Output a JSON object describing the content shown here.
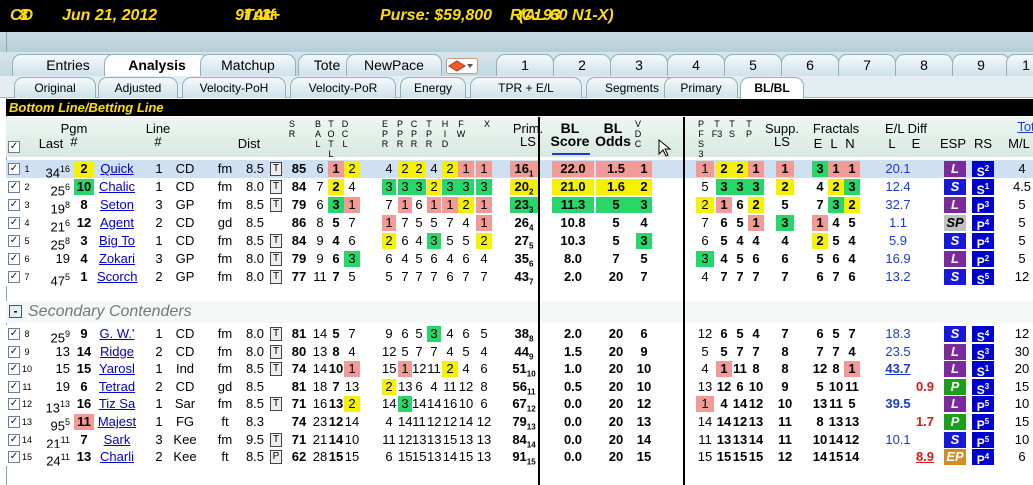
{
  "title": {
    "track": "CD",
    "race": "8",
    "date": "Jun 21, 2012",
    "dist": "9f",
    "surface": "Turf",
    "type": "AL",
    "age": "3+",
    "purse": "Purse: $59,800",
    "rc": "RC: 93",
    "cond": "(AL 60 N1-X)"
  },
  "tabs1": [
    "Entries",
    "Analysis",
    "Matchup",
    "Tote",
    "NewPace",
    "1",
    "2",
    "3",
    "4",
    "5",
    "6",
    "7",
    "8",
    "9",
    "1"
  ],
  "tabs2": [
    "Original",
    "Adjusted",
    "Velocity-PoH",
    "Velocity-PoR",
    "Energy",
    "TPR + E/L",
    "Segments",
    "Primary",
    "BL/BL"
  ],
  "section": "Bottom Line/Betting Line",
  "headers": {
    "last": "Last",
    "pgm": "Pgm\n#",
    "line": "Line\n#",
    "dist": "Dist",
    "sr": "S\nR",
    "batl": "B\nA\nL",
    "totl": "T\nO\nT\nL",
    "dcl": "D\nC\nL",
    "epr": "E\nP\nR",
    "ppr": "P\nP\nR",
    "cpr": "C\nP\nR",
    "tpr": "T\nP\nR",
    "hid": "H\nI\nD",
    "fw": "F\nW",
    "x": "X",
    "prim": "Prim.\nLS",
    "bl1": "BL\nScore",
    "bl2": "BL\nOdds",
    "vdc": "V\nD\nC",
    "pfs3": "P\nF\nS\n3",
    "tf3": "T\nF3",
    "ts": "T\nS",
    "tp": "T\nP",
    "supp": "Supp.\nLS",
    "fractals": "Fractals",
    "e": "E",
    "l": "L",
    "n": "N",
    "el": "E/L Diff",
    "elL": "L",
    "elE": "E",
    "esp": "ESP",
    "rs": "RS",
    "tot": "Tot",
    "ml": "M/L"
  },
  "secondary_label": "Secondary Contenders",
  "rows": [
    {
      "n": "1",
      "last": "34",
      "lastsup": "16",
      "pgm": "2",
      "name": "Quick",
      "ln": "1",
      "trk": "CD",
      "cond": "fm",
      "dist": "8.5",
      "t": "T",
      "sr": "85",
      "ba": "6",
      "to": "1",
      "dc": "2",
      "e": "4",
      "p": "2",
      "cp": "2",
      "tp": "4",
      "hi": "2",
      "fw": "1",
      "x": "1",
      "prim": "16",
      "primsup": "1",
      "bl1": "22.0",
      "bl2": "1.5",
      "vdc": "1",
      "pf": "1",
      "tf": "2",
      "ts": "2",
      "tpp": "1",
      "supp": "1",
      "fe": "3",
      "fl": "1",
      "fn": "1",
      "el": "20.1",
      "ee": "",
      "esp": "L",
      "rs": "S",
      "rssup": "2",
      "ml": "4"
    },
    {
      "n": "2",
      "last": "25",
      "lastsup": "6",
      "pgm": "10",
      "name": "Chalic",
      "ln": "1",
      "trk": "CD",
      "cond": "fm",
      "dist": "8.0",
      "t": "T",
      "sr": "84",
      "ba": "7",
      "to": "2",
      "dc": "4",
      "e": "3",
      "p": "3",
      "cp": "3",
      "tp": "2",
      "hi": "3",
      "fw": "3",
      "x": "3",
      "prim": "20",
      "primsup": "2",
      "bl1": "21.0",
      "bl2": "1.6",
      "vdc": "2",
      "pf": "5",
      "tf": "3",
      "ts": "3",
      "tpp": "3",
      "supp": "2",
      "fe": "4",
      "fl": "2",
      "fn": "3",
      "el": "12.4",
      "ee": "",
      "esp": "S",
      "rs": "S",
      "rssup": "1",
      "ml": "4.5"
    },
    {
      "n": "3",
      "last": "19",
      "lastsup": "8",
      "pgm": "8",
      "name": "Seton",
      "ln": "3",
      "trk": "GP",
      "cond": "fm",
      "dist": "8.5",
      "t": "T",
      "sr": "79",
      "ba": "6",
      "to": "3",
      "dc": "1",
      "e": "7",
      "p": "1",
      "cp": "6",
      "tp": "1",
      "hi": "1",
      "fw": "2",
      "x": "1",
      "prim": "23",
      "primsup": "3",
      "bl1": "11.3",
      "bl2": "5",
      "vdc": "3",
      "pf": "2",
      "tf": "1",
      "ts": "6",
      "tpp": "2",
      "supp": "5",
      "fe": "7",
      "fl": "3",
      "fn": "2",
      "el": "32.7",
      "ee": "",
      "esp": "L",
      "rs": "P",
      "rssup": "3",
      "ml": "5"
    },
    {
      "n": "4",
      "last": "21",
      "lastsup": "6",
      "pgm": "12",
      "name": "Agent",
      "ln": "2",
      "trk": "CD",
      "cond": "gd",
      "dist": "8.5",
      "t": "",
      "sr": "86",
      "ba": "8",
      "to": "5",
      "dc": "7",
      "e": "1",
      "p": "7",
      "cp": "5",
      "tp": "5",
      "hi": "7",
      "fw": "4",
      "x": "1",
      "prim": "26",
      "primsup": "4",
      "bl1": "10.8",
      "bl2": "5",
      "vdc": "4",
      "pf": "7",
      "tf": "6",
      "ts": "5",
      "tpp": "1",
      "supp": "3",
      "fe": "1",
      "fl": "4",
      "fn": "5",
      "el": "1.1",
      "ee": "",
      "esp": "SP",
      "rs": "P",
      "rssup": "4",
      "ml": "5"
    },
    {
      "n": "5",
      "last": "25",
      "lastsup": "8",
      "pgm": "3",
      "name": "Big To",
      "ln": "1",
      "trk": "CD",
      "cond": "fm",
      "dist": "8.5",
      "t": "T",
      "sr": "84",
      "ba": "9",
      "to": "4",
      "dc": "6",
      "e": "2",
      "p": "6",
      "cp": "4",
      "tp": "3",
      "hi": "5",
      "fw": "5",
      "x": "2",
      "prim": "27",
      "primsup": "5",
      "bl1": "10.3",
      "bl2": "5",
      "vdc": "3",
      "pf": "6",
      "tf": "5",
      "ts": "4",
      "tpp": "4",
      "supp": "4",
      "fe": "2",
      "fl": "5",
      "fn": "4",
      "el": "5.9",
      "ee": "",
      "esp": "S",
      "rs": "P",
      "rssup": "4",
      "ml": "5"
    },
    {
      "n": "6",
      "last": "19",
      "lastsup": "",
      "pgm": "4",
      "name": "Zokari",
      "ln": "3",
      "trk": "GP",
      "cond": "fm",
      "dist": "8.0",
      "t": "T",
      "sr": "79",
      "ba": "9",
      "to": "6",
      "dc": "3",
      "e": "6",
      "p": "4",
      "cp": "5",
      "tp": "6",
      "hi": "4",
      "fw": "6",
      "x": "4",
      "prim": "35",
      "primsup": "6",
      "bl1": "8.0",
      "bl2": "7",
      "vdc": "5",
      "pf": "3",
      "tf": "4",
      "ts": "5",
      "tpp": "6",
      "supp": "6",
      "fe": "5",
      "fl": "6",
      "fn": "4",
      "el": "16.9",
      "ee": "",
      "esp": "L",
      "rs": "P",
      "rssup": "2",
      "ml": "5"
    },
    {
      "n": "7",
      "last": "47",
      "lastsup": "5",
      "pgm": "1",
      "name": "Scorch",
      "ln": "2",
      "trk": "GP",
      "cond": "fm",
      "dist": "8.0",
      "t": "T",
      "sr": "77",
      "ba": "11",
      "to": "7",
      "dc": "5",
      "e": "5",
      "p": "7",
      "cp": "7",
      "tp": "7",
      "hi": "6",
      "fw": "7",
      "x": "7",
      "prim": "43",
      "primsup": "7",
      "bl1": "2.0",
      "bl2": "20",
      "vdc": "7",
      "pf": "4",
      "tf": "7",
      "ts": "7",
      "tpp": "7",
      "supp": "7",
      "fe": "6",
      "fl": "7",
      "fn": "6",
      "el": "13.2",
      "ee": "",
      "esp": "S",
      "rs": "S",
      "rssup": "5",
      "ml": "12"
    },
    {
      "n": "8",
      "last": "25",
      "lastsup": "9",
      "pgm": "9",
      "name": "G. W.'",
      "ln": "1",
      "trk": "CD",
      "cond": "fm",
      "dist": "8.0",
      "t": "T",
      "sr": "81",
      "ba": "14",
      "to": "5",
      "dc": "7",
      "e": "9",
      "p": "6",
      "cp": "5",
      "tp": "3",
      "hi": "4",
      "fw": "6",
      "x": "5",
      "prim": "38",
      "primsup": "8",
      "bl1": "2.0",
      "bl2": "20",
      "vdc": "6",
      "pf": "12",
      "tf": "6",
      "ts": "5",
      "tpp": "4",
      "supp": "7",
      "fe": "6",
      "fl": "5",
      "fn": "7",
      "el": "18.3",
      "ee": "",
      "esp": "S",
      "rs": "S",
      "rssup": "4",
      "ml": "12"
    },
    {
      "n": "9",
      "last": "13",
      "lastsup": "",
      "pgm": "14",
      "name": "Ridge",
      "ln": "2",
      "trk": "CD",
      "cond": "fm",
      "dist": "8.0",
      "t": "T",
      "sr": "80",
      "ba": "13",
      "to": "8",
      "dc": "4",
      "e": "12",
      "p": "5",
      "cp": "7",
      "tp": "7",
      "hi": "4",
      "fw": "5",
      "x": "4",
      "prim": "44",
      "primsup": "9",
      "bl1": "1.5",
      "bl2": "20",
      "vdc": "9",
      "pf": "5",
      "tf": "5",
      "ts": "7",
      "tpp": "7",
      "supp": "8",
      "fe": "7",
      "fl": "7",
      "fn": "4",
      "el": "23.5",
      "ee": "",
      "esp": "L",
      "rs": "S",
      "rssup": "3",
      "ml": "30"
    },
    {
      "n": "10",
      "last": "15",
      "lastsup": "",
      "pgm": "15",
      "name": "Yarosl",
      "ln": "1",
      "trk": "Ind",
      "cond": "fm",
      "dist": "8.5",
      "t": "T",
      "sr": "74",
      "ba": "14",
      "to": "10",
      "dc": "1",
      "e": "15",
      "p": "1",
      "cp": "12",
      "tp": "11",
      "hi": "2",
      "fw": "4",
      "x": "6",
      "prim": "51",
      "primsup": "10",
      "bl1": "1.0",
      "bl2": "20",
      "vdc": "10",
      "pf": "4",
      "tf": "1",
      "ts": "11",
      "tpp": "8",
      "supp": "8",
      "fe": "12",
      "fl": "8",
      "fn": "1",
      "el": "43.7",
      "ee": "",
      "esp": "L",
      "rs": "S",
      "rssup": "1",
      "ml": "20"
    },
    {
      "n": "11",
      "last": "19",
      "lastsup": "",
      "pgm": "6",
      "name": "Tetrad",
      "ln": "2",
      "trk": "CD",
      "cond": "gd",
      "dist": "8.5",
      "t": "",
      "sr": "81",
      "ba": "18",
      "to": "7",
      "dc": "13",
      "e": "2",
      "p": "13",
      "cp": "6",
      "tp": "4",
      "hi": "11",
      "fw": "12",
      "x": "8",
      "prim": "56",
      "primsup": "11",
      "bl1": "0.5",
      "bl2": "20",
      "vdc": "10",
      "pf": "13",
      "tf": "12",
      "ts": "6",
      "tpp": "10",
      "supp": "9",
      "fe": "5",
      "fl": "10",
      "fn": "11",
      "el": "",
      "ee": "0.9",
      "esp": "P",
      "rs": "S",
      "rssup": "3",
      "ml": "15"
    },
    {
      "n": "12",
      "last": "13",
      "lastsup": "13",
      "pgm": "16",
      "name": "Tiz Sa",
      "ln": "1",
      "trk": "Sar",
      "cond": "fm",
      "dist": "8.5",
      "t": "T",
      "sr": "71",
      "ba": "16",
      "to": "13",
      "dc": "2",
      "e": "14",
      "p": "3",
      "cp": "14",
      "tp": "14",
      "hi": "16",
      "fw": "10",
      "x": "6",
      "prim": "67",
      "primsup": "12",
      "bl1": "0.0",
      "bl2": "20",
      "vdc": "12",
      "pf": "1",
      "tf": "4",
      "ts": "14",
      "tpp": "12",
      "supp": "10",
      "fe": "13",
      "fl": "11",
      "fn": "5",
      "el": "39.5",
      "ee": "",
      "esp": "L",
      "rs": "P",
      "rssup": "5",
      "ml": "10"
    },
    {
      "n": "13",
      "last": "95",
      "lastsup": "5",
      "pgm": "11",
      "name": "Majest",
      "ln": "1",
      "trk": "FG",
      "cond": "ft",
      "dist": "8.3",
      "t": "",
      "sr": "74",
      "ba": "23",
      "to": "12",
      "dc": "14",
      "e": "4",
      "p": "14",
      "cp": "11",
      "tp": "12",
      "hi": "12",
      "fw": "14",
      "x": "12",
      "prim": "79",
      "primsup": "13",
      "bl1": "0.0",
      "bl2": "20",
      "vdc": "13",
      "pf": "14",
      "tf": "14",
      "ts": "12",
      "tpp": "13",
      "supp": "11",
      "fe": "8",
      "fl": "13",
      "fn": "13",
      "el": "",
      "ee": "1.7",
      "esp": "P",
      "rs": "P",
      "rssup": "5",
      "ml": "15"
    },
    {
      "n": "14",
      "last": "21",
      "lastsup": "11",
      "pgm": "7",
      "name": "Sark",
      "ln": "3",
      "trk": "Kee",
      "cond": "fm",
      "dist": "9.5",
      "t": "T",
      "sr": "71",
      "ba": "21",
      "to": "14",
      "dc": "10",
      "e": "11",
      "p": "12",
      "cp": "13",
      "tp": "13",
      "hi": "15",
      "fw": "13",
      "x": "13",
      "prim": "84",
      "primsup": "14",
      "bl1": "0.0",
      "bl2": "20",
      "vdc": "14",
      "pf": "11",
      "tf": "13",
      "ts": "13",
      "tpp": "14",
      "supp": "11",
      "fe": "10",
      "fl": "14",
      "fn": "12",
      "el": "10.1",
      "ee": "",
      "esp": "S",
      "rs": "P",
      "rssup": "5",
      "ml": "10"
    },
    {
      "n": "15",
      "last": "24",
      "lastsup": "11",
      "pgm": "13",
      "name": "Charli",
      "ln": "2",
      "trk": "Kee",
      "cond": "ft",
      "dist": "8.5",
      "t": "P",
      "sr": "62",
      "ba": "28",
      "to": "15",
      "dc": "15",
      "e": "6",
      "p": "15",
      "cp": "15",
      "tp": "13",
      "hi": "14",
      "fw": "15",
      "x": "13",
      "prim": "91",
      "primsup": "15",
      "bl1": "0.0",
      "bl2": "20",
      "vdc": "15",
      "pf": "15",
      "tf": "15",
      "ts": "15",
      "tpp": "15",
      "supp": "12",
      "fe": "14",
      "fl": "15",
      "fn": "14",
      "el": "",
      "ee": "8.9",
      "esp": "EP",
      "rs": "P",
      "rssup": "4",
      "ml": "6"
    }
  ],
  "colors": {
    "yellow": "#f5f200",
    "green": "#28d66a",
    "red": "#f29a96",
    "blue": "#0000cc",
    "esp_L": "#7a2a9a",
    "esp_S": "#1818d8",
    "esp_SP": "#c0c0c0",
    "esp_P": "#18a018",
    "esp_EP": "#d98a22"
  }
}
